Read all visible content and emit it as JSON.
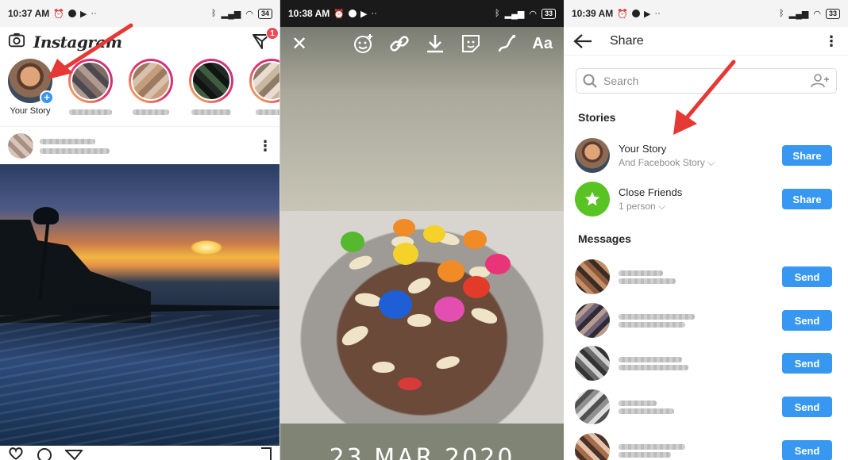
{
  "left_screen": {
    "status": {
      "time": "10:37 AM",
      "battery": "34"
    },
    "app_name": "Instagram",
    "direct_badge": "1",
    "stories": [
      {
        "label": "Your Story"
      }
    ]
  },
  "middle_screen": {
    "status": {
      "time": "10:38 AM",
      "battery": "33"
    },
    "text_tool_label": "Aa",
    "date_sticker": "23 MAR 2020"
  },
  "right_screen": {
    "status": {
      "time": "10:39 AM",
      "battery": "33"
    },
    "title": "Share",
    "search_placeholder": "Search",
    "sections": {
      "stories": "Stories",
      "messages": "Messages"
    },
    "story_targets": [
      {
        "name": "Your Story",
        "sub": "And Facebook Story",
        "button": "Share"
      },
      {
        "name": "Close Friends",
        "sub": "1 person",
        "button": "Share"
      }
    ],
    "message_button": "Send"
  },
  "colors": {
    "accent_blue": "#3897f0",
    "badge_red": "#ed4956",
    "close_friends_green": "#58c322",
    "annotation_arrow": "#e53935"
  }
}
